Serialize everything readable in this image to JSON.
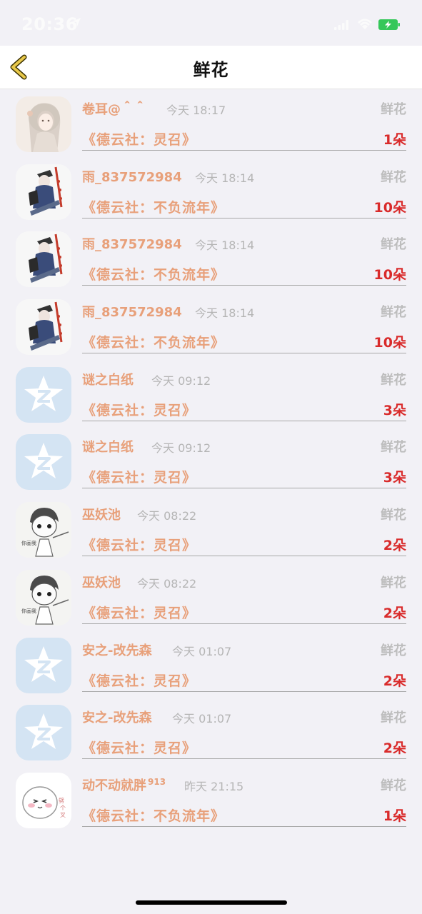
{
  "status_bar": {
    "time": "20:36"
  },
  "nav": {
    "title": "鲜花"
  },
  "colors": {
    "name": "#e8a07a",
    "count": "#d92b2b",
    "muted": "#b5b5b5"
  },
  "rows": [
    {
      "avatar": "avatar-portrait-girl",
      "name": "卷耳@＾＾",
      "level": "",
      "time": "今天 18:17",
      "type": "鲜花",
      "novel": "《德云社：灵召》",
      "count": "1朵"
    },
    {
      "avatar": "avatar-warrior",
      "name": "雨_837572984",
      "level": "",
      "time": "今天 18:14",
      "type": "鲜花",
      "novel": "《德云社：不负流年》",
      "count": "10朵"
    },
    {
      "avatar": "avatar-warrior",
      "name": "雨_837572984",
      "level": "",
      "time": "今天 18:14",
      "type": "鲜花",
      "novel": "《德云社：不负流年》",
      "count": "10朵"
    },
    {
      "avatar": "avatar-warrior",
      "name": "雨_837572984",
      "level": "",
      "time": "今天 18:14",
      "type": "鲜花",
      "novel": "《德云社：不负流年》",
      "count": "10朵"
    },
    {
      "avatar": "avatar-default-star",
      "name": "谜之白纸",
      "level": "",
      "time": "今天 09:12",
      "type": "鲜花",
      "novel": "《德云社：灵召》",
      "count": "3朵"
    },
    {
      "avatar": "avatar-default-star",
      "name": "谜之白纸",
      "level": "",
      "time": "今天 09:12",
      "type": "鲜花",
      "novel": "《德云社：灵召》",
      "count": "3朵"
    },
    {
      "avatar": "avatar-sketch-boy",
      "name": "巫妖池",
      "level": "",
      "time": "今天 08:22",
      "type": "鲜花",
      "novel": "《德云社：灵召》",
      "count": "2朵"
    },
    {
      "avatar": "avatar-sketch-boy",
      "name": "巫妖池",
      "level": "",
      "time": "今天 08:22",
      "type": "鲜花",
      "novel": "《德云社：灵召》",
      "count": "2朵"
    },
    {
      "avatar": "avatar-default-star",
      "name": "安之-改先森",
      "level": "",
      "time": "今天 01:07",
      "type": "鲜花",
      "novel": "《德云社：灵召》",
      "count": "2朵"
    },
    {
      "avatar": "avatar-default-star",
      "name": "安之-改先森",
      "level": "",
      "time": "今天 01:07",
      "type": "鲜花",
      "novel": "《德云社：灵召》",
      "count": "2朵"
    },
    {
      "avatar": "avatar-cartoon-blob",
      "name": "动不动就胖",
      "level": "913",
      "time": "昨天 21:15",
      "type": "鲜花",
      "novel": "《德云社：不负流年》",
      "count": "1朵"
    }
  ]
}
